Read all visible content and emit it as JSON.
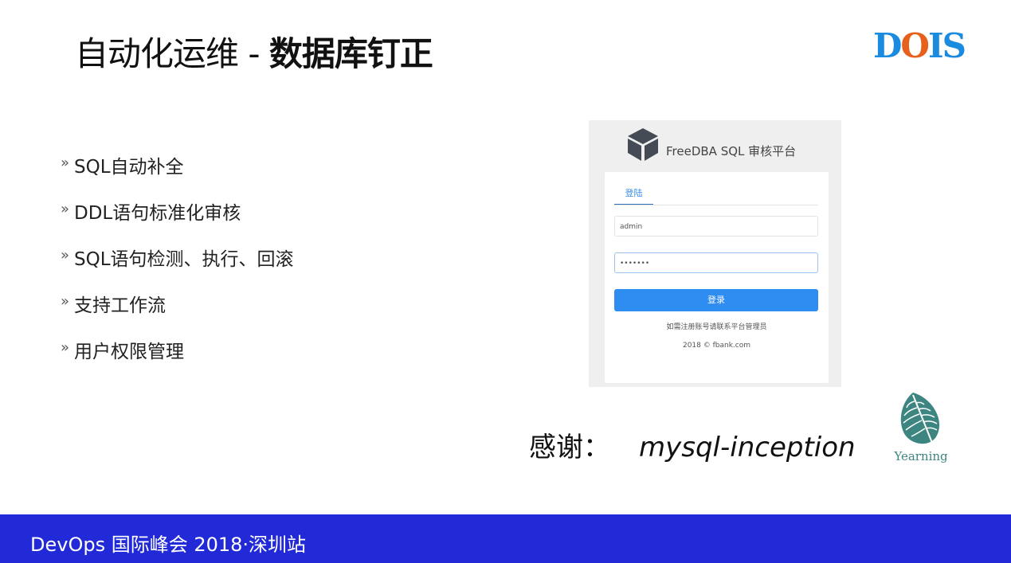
{
  "title": {
    "prefix": "自动化运维 - ",
    "bold": "数据库钉正"
  },
  "logo": {
    "text_part1": "D",
    "text_part2": "O",
    "text_part3": "IS",
    "colors": {
      "blue": "#1b8be0",
      "orange": "#e8611c"
    }
  },
  "bullets": {
    "marker": "»",
    "items": [
      "SQL自动补全",
      "DDL语句标准化审核",
      "SQL语句检测、执行、回滚",
      "支持工作流",
      "用户权限管理"
    ]
  },
  "screenshot": {
    "app_title": "FreeDBA SQL 审核平台",
    "tab": "登陆",
    "username": "admin",
    "password": "•••••••",
    "login_button": "登录",
    "register_note": "如需注册账号请联系平台管理员",
    "copyright": "2018 © fbank.com",
    "accent": "#2f8cf0"
  },
  "thanks": {
    "label": "感谢：",
    "project": "mysql-inception"
  },
  "yearning_logo": {
    "text": "Yearning",
    "color": "#3d8580"
  },
  "footer": {
    "text": "DevOps 国际峰会 2018·深圳站",
    "color": "#2229d6"
  }
}
